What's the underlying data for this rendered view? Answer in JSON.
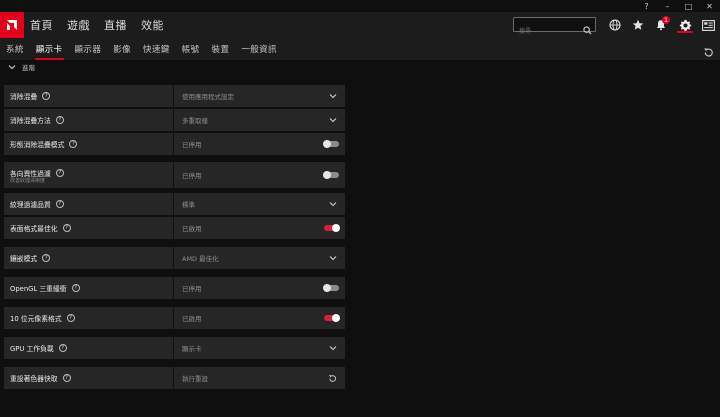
{
  "window": {
    "help_label": "?",
    "minimize_label": "–",
    "maximize_label": "□",
    "close_label": "✕"
  },
  "main_nav": [
    "首頁",
    "遊戲",
    "直播",
    "效能"
  ],
  "search": {
    "placeholder": "搜尋"
  },
  "notifications": {
    "count": "1"
  },
  "tabs": [
    "系統",
    "顯示卡",
    "顯示器",
    "影像",
    "快速鍵",
    "帳號",
    "裝置",
    "一般資訊"
  ],
  "active_tab": "顯示卡",
  "section": {
    "title": "進階"
  },
  "settings": [
    {
      "label": "消除混疊",
      "value": "使用應用程式設定",
      "control": "dropdown"
    },
    {
      "label": "消除混疊方法",
      "value": "多重取樣",
      "control": "dropdown"
    },
    {
      "label": "形態消除混疊模式",
      "value": "已停用",
      "control": "toggle",
      "state": "off"
    },
    {
      "label": "各向異性過濾",
      "sublabel": "改善紋理清晰度",
      "value": "已停用",
      "control": "toggle",
      "state": "off"
    },
    {
      "label": "紋理過濾品質",
      "value": "標準",
      "control": "dropdown"
    },
    {
      "label": "表面格式最佳化",
      "value": "已啟用",
      "control": "toggle",
      "state": "on"
    },
    {
      "label": "鑲嵌模式",
      "value": "AMD 最佳化",
      "control": "dropdown"
    },
    {
      "label": "OpenGL 三重緩衝",
      "value": "已停用",
      "control": "toggle",
      "state": "off"
    },
    {
      "label": "10 位元像素格式",
      "value": "已啟用",
      "control": "toggle",
      "state": "on"
    },
    {
      "label": "GPU 工作負載",
      "value": "顯示卡",
      "control": "dropdown"
    },
    {
      "label": "重設著色器快取",
      "value": "執行重設",
      "control": "reset"
    }
  ],
  "colors": {
    "accent": "#e3001b",
    "row_bg": "#262626",
    "header_bg": "#1c1c1c",
    "page_bg": "#0f0f0f"
  }
}
